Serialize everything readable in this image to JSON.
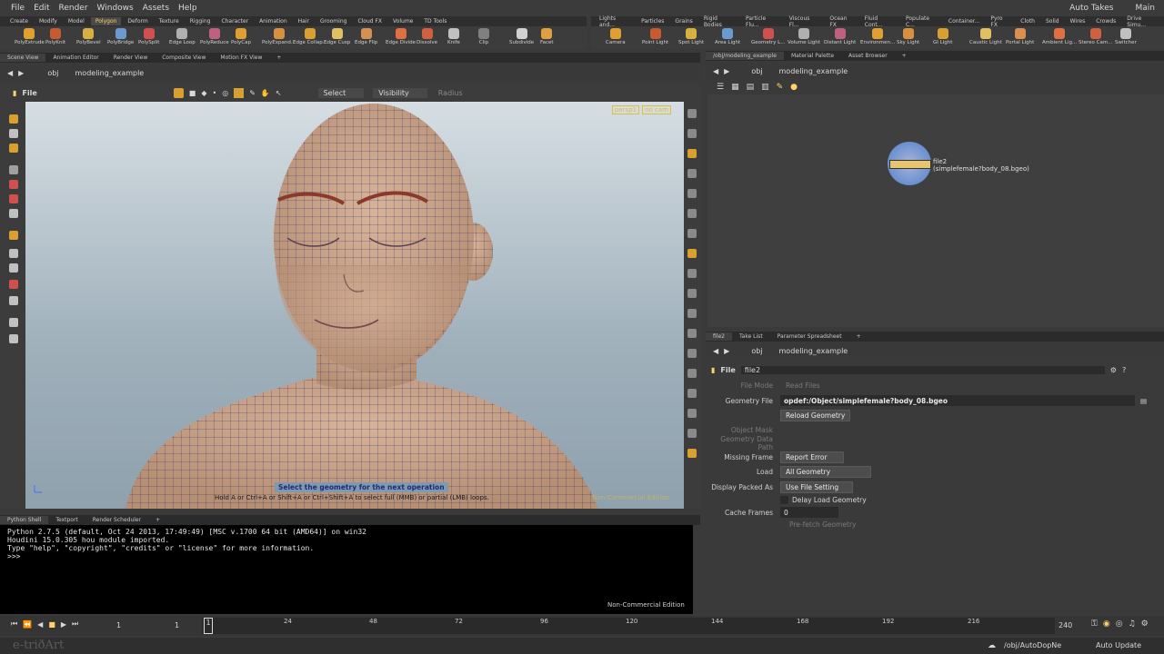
{
  "menubar": {
    "items": [
      "File",
      "Edit",
      "Render",
      "Windows",
      "Assets",
      "Help"
    ],
    "auto_takes": "Auto Takes",
    "desktop": "Main"
  },
  "shelf_left": {
    "tabs": [
      "Create",
      "Modify",
      "Model",
      "Polygon",
      "Deform",
      "Texture",
      "Rigging",
      "Character",
      "Animation",
      "Hair",
      "Grooming",
      "Cloud FX",
      "Volume",
      "TD Tools"
    ],
    "active_tab": "Polygon",
    "tools": [
      "PolyExtrude",
      "PolyKnit",
      "PolyBevel",
      "PolyBridge",
      "PolySplit",
      "Edge Loop",
      "PolyReduce",
      "PolyCap",
      "PolyExpand...",
      "Edge Collap...",
      "Edge Cusp",
      "Edge Flip",
      "Edge Divide",
      "Dissolve",
      "Knife",
      "Clip",
      "Subdivide",
      "Facet"
    ]
  },
  "shelf_right": {
    "tabs": [
      "Lights and...",
      "Particles",
      "Grains",
      "Rigid Bodies",
      "Particle Flu...",
      "Viscous Fl...",
      "Ocean FX",
      "Fluid Cont...",
      "Populate C...",
      "Container...",
      "Pyro FX",
      "Cloth",
      "Solid",
      "Wires",
      "Crowds",
      "Drive Simu..."
    ],
    "tools": [
      "Camera",
      "Point Light",
      "Spot Light",
      "Area Light",
      "Geometry L...",
      "Volume Light",
      "Distant Light",
      "Environmen...",
      "Sky Light",
      "GI Light",
      "Caustic Light",
      "Portal Light",
      "Ambient Lig...",
      "Stereo Cam...",
      "Switcher"
    ]
  },
  "left_pane": {
    "tabs": [
      "Scene View",
      "Animation Editor",
      "Render View",
      "Composite View",
      "Motion FX View"
    ],
    "path_root": "obj",
    "path_node": "modeling_example",
    "context": "File",
    "select_label": "Select",
    "visibility_label": "Visibility",
    "radius_label": "Radius",
    "camera_persp": "persp1",
    "camera_nocam": "no cam",
    "prompt_title": "Select the geometry for the next operation",
    "prompt_hint": "Hold A or Ctrl+A or Shift+A or Ctrl+Shift+A to select full (MMB) or partial (LMB) loops.",
    "watermark": "Non-Commercial Edition"
  },
  "right_top": {
    "tabs": [
      "/obj/modeling_example",
      "Material Palette",
      "Asset Browser"
    ],
    "path_root": "obj",
    "path_node": "modeling_example",
    "node_name": "file2",
    "node_path": "(simplefemale?body_08.bgeo)"
  },
  "param_pane": {
    "tabs": [
      "file2",
      "Take List",
      "Parameter Spreadsheet"
    ],
    "path_root": "obj",
    "path_node": "modeling_example",
    "node_type": "File",
    "node_name": "file2",
    "file_mode_label": "File Mode",
    "file_mode_value": "Read Files",
    "geometry_file_label": "Geometry File",
    "geometry_file_value": "opdef:/Object/simplefemale?body_08.bgeo",
    "reload_label": "Reload Geometry",
    "object_mask_label": "Object Mask",
    "geometry_data_path_label": "Geometry Data Path",
    "missing_frame_label": "Missing Frame",
    "missing_frame_value": "Report Error",
    "load_label": "Load",
    "load_value": "All Geometry",
    "display_packed_label": "Display Packed As",
    "display_packed_value": "Use File Setting",
    "delay_load_label": "Delay Load Geometry",
    "cache_frames_label": "Cache Frames",
    "cache_frames_value": "0",
    "prefetch_label": "Pre-fetch Geometry"
  },
  "python_shell": {
    "tabs": [
      "Python Shell",
      "Textport",
      "Render Scheduler"
    ],
    "lines": [
      "Python 2.7.5 (default, Oct 24 2013, 17:49:49) [MSC v.1700 64 bit (AMD64)] on win32",
      "Houdini 15.0.305 hou module imported.",
      "Type \"help\", \"copyright\", \"credits\" or \"license\" for more information.",
      ">>>"
    ],
    "watermark": "Non-Commercial Edition"
  },
  "timeline": {
    "start_frame": "1",
    "current_frame": "1",
    "range_start": "1",
    "ticks": [
      "24",
      "48",
      "72",
      "96",
      "120",
      "144",
      "168",
      "192",
      "216"
    ],
    "end_frame": "240"
  },
  "statusbar": {
    "brand": "e-triðArt",
    "path": "/obj/AutoDopNe",
    "auto_update": "Auto Update"
  },
  "colors": {
    "accent": "#ffd26a",
    "wire": "#2f3fd0",
    "skin": "#c9a48a",
    "node_ring": "#6a8fd0"
  }
}
